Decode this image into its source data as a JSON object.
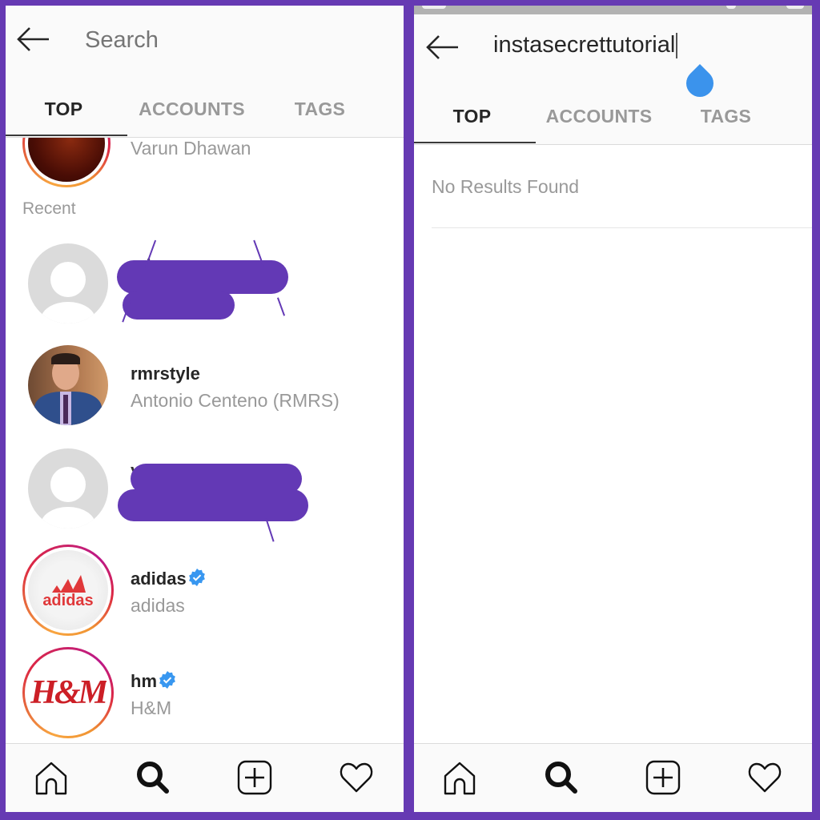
{
  "colors": {
    "frame": "#663ab3",
    "redaction": "#6339b5",
    "caret_handle": "#3b93ec",
    "verified_badge": "#3897f0",
    "text_primary": "#262626",
    "text_secondary": "#999999"
  },
  "left_screen": {
    "header": {
      "back_icon": "arrow-left-icon",
      "search_placeholder": "Search",
      "search_value": ""
    },
    "tabs": [
      {
        "label": "TOP",
        "active": true
      },
      {
        "label": "ACCOUNTS",
        "active": false
      },
      {
        "label": "TAGS",
        "active": false
      }
    ],
    "partial_top_item": {
      "fullname": "Varun Dhawan"
    },
    "recent_label": "Recent",
    "recent_items": [
      {
        "username": "[redacted]",
        "fullname": "[redacted]",
        "verified": false,
        "avatar": "default-avatar"
      },
      {
        "username": "rmrstyle",
        "fullname": "Antonio Centeno (RMRS)",
        "verified": false,
        "avatar": "photo"
      },
      {
        "username": "[redacted]",
        "fullname": "[redacted]",
        "verified": false,
        "avatar": "default-avatar"
      },
      {
        "username": "adidas",
        "fullname": "adidas",
        "verified": true,
        "avatar": "adidas-logo",
        "logo_text": "adidas"
      },
      {
        "username": "hm",
        "fullname": "H&M",
        "verified": true,
        "avatar": "hm-logo",
        "logo_text": "H&M"
      }
    ],
    "bottom_nav": [
      {
        "icon": "home-icon",
        "active": false
      },
      {
        "icon": "search-icon",
        "active": true
      },
      {
        "icon": "add-post-icon",
        "active": false
      },
      {
        "icon": "heart-icon",
        "active": false
      }
    ]
  },
  "right_screen": {
    "header": {
      "back_icon": "arrow-left-icon",
      "search_value": "instasecrettutorial"
    },
    "tabs": [
      {
        "label": "TOP",
        "active": true
      },
      {
        "label": "ACCOUNTS",
        "active": false
      },
      {
        "label": "TAGS",
        "active": false
      }
    ],
    "message": "No Results Found",
    "bottom_nav": [
      {
        "icon": "home-icon",
        "active": false
      },
      {
        "icon": "search-icon",
        "active": true
      },
      {
        "icon": "add-post-icon",
        "active": false
      },
      {
        "icon": "heart-icon",
        "active": false
      }
    ]
  }
}
